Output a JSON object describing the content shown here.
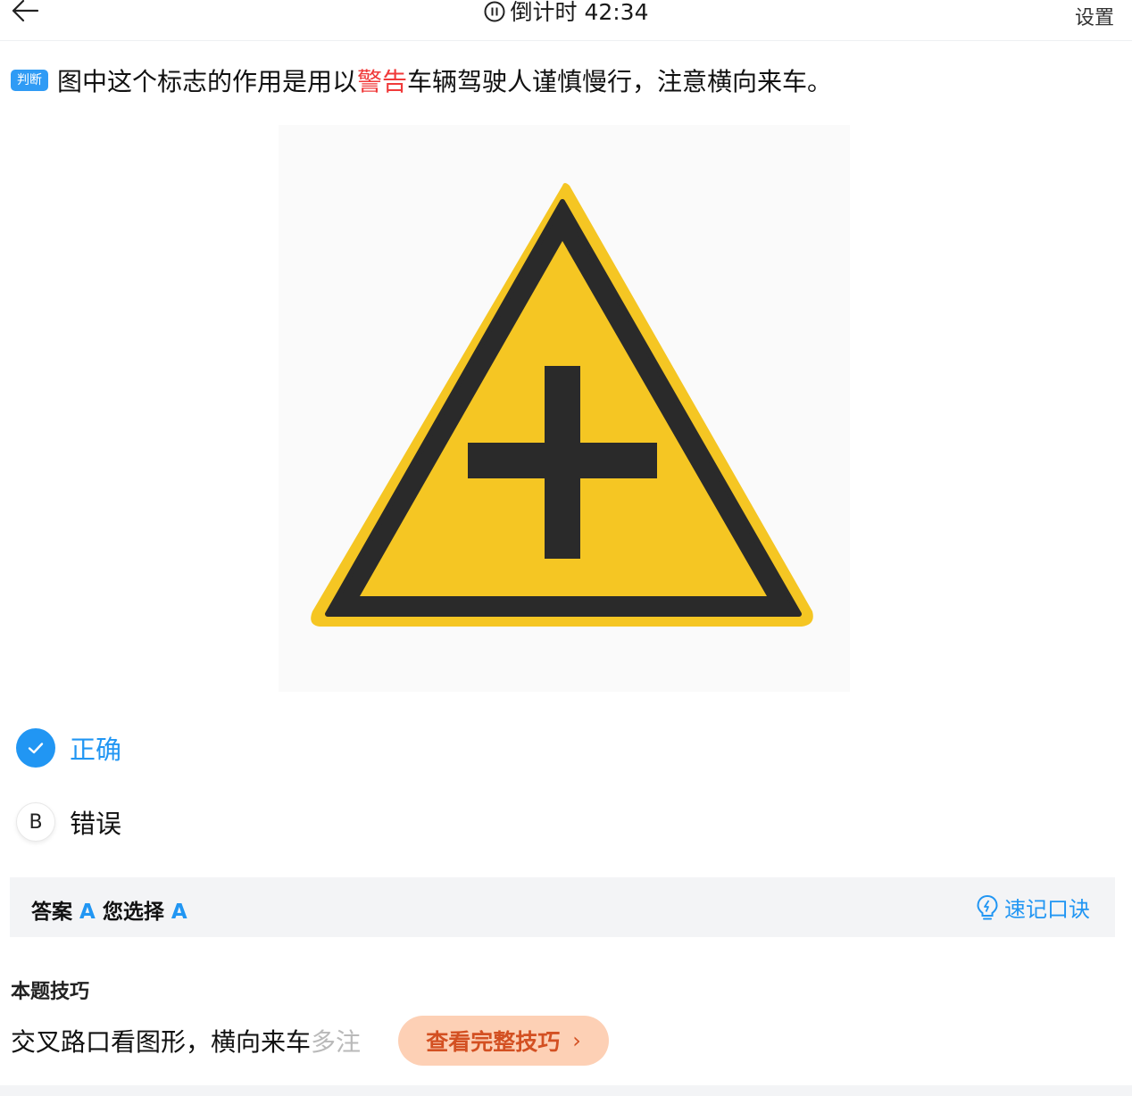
{
  "header": {
    "back_icon": "arrow-left-icon",
    "timer_icon": "pause-circle-icon",
    "timer_label": "倒计时 42:34",
    "settings_label": "设置"
  },
  "question": {
    "type_badge": "判断",
    "text_before": "图中这个标志的作用是用以",
    "text_highlight": "警告",
    "text_after": "车辆驾驶人谨慎慢行，注意横向来车。",
    "highlight_color": "#f03a3a",
    "image": "crossroad-warning-sign"
  },
  "options": [
    {
      "letter": "A",
      "label": "正确",
      "selected": true,
      "icon": "check-icon"
    },
    {
      "letter": "B",
      "label": "错误",
      "selected": false
    }
  ],
  "answer": {
    "answer_label": "答案",
    "answer_value": "A",
    "choice_label": "您选择",
    "choice_value": "A",
    "mnemonic_icon": "lightbulb-icon",
    "mnemonic_label": "速记口诀"
  },
  "tip": {
    "title": "本题技巧",
    "text": "交叉路口看图形，横向来车",
    "text_faded": "多注",
    "button_label": "查看完整技巧",
    "button_icon": "chevron-right-icon"
  },
  "colors": {
    "accent": "#2196f3",
    "sign_yellow": "#f5c623",
    "sign_black": "#2a2a2a",
    "tip_button_bg": "#fdd0b5",
    "tip_button_text": "#d35022"
  }
}
